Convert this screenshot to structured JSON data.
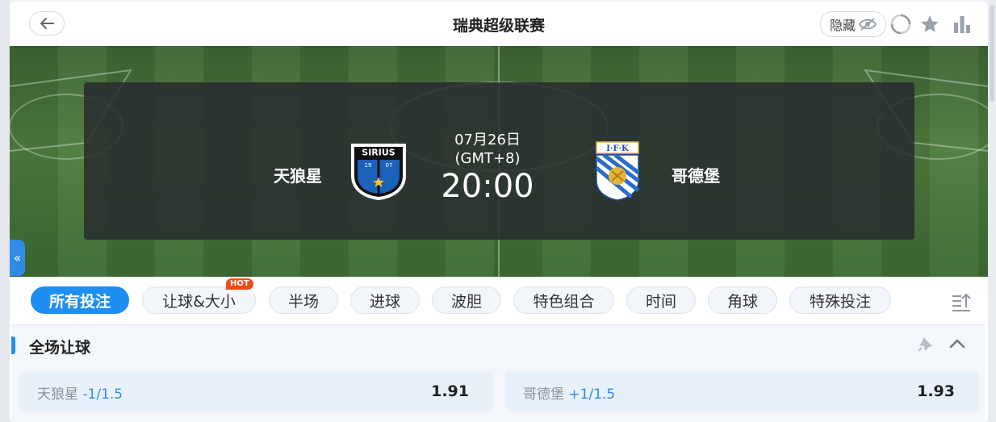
{
  "header": {
    "title": "瑞典超级联赛",
    "hide_label": "隐藏"
  },
  "match": {
    "home_team": "天狼星",
    "away_team": "哥德堡",
    "date": "07月26日",
    "timezone": "(GMT+8)",
    "time": "20:00",
    "home_crest_text": "SIRIUS",
    "home_crest_year_left": "19",
    "home_crest_year_right": "07",
    "away_crest_text": "I·F·K"
  },
  "tabs": [
    {
      "label": "所有投注",
      "active": true
    },
    {
      "label": "让球&大小",
      "badge": "HOT"
    },
    {
      "label": "半场"
    },
    {
      "label": "进球"
    },
    {
      "label": "波胆"
    },
    {
      "label": "特色组合"
    },
    {
      "label": "时间"
    },
    {
      "label": "角球"
    },
    {
      "label": "特殊投注"
    }
  ],
  "market": {
    "title": "全场让球",
    "selections": [
      {
        "team": "天狼星",
        "line": "-1/1.5",
        "odds": "1.91"
      },
      {
        "team": "哥德堡",
        "line": "+1/1.5",
        "odds": "1.93"
      }
    ]
  },
  "side_toggle": "«",
  "colors": {
    "accent": "#1e8ff0",
    "hot": "#f04a1a",
    "pitch": "#4f7d3f"
  },
  "icons": [
    "back-arrow-icon",
    "eye-off-icon",
    "refresh-icon",
    "star-icon",
    "stats-icon",
    "collapse-all-icon",
    "pin-icon",
    "chevron-up-icon"
  ]
}
